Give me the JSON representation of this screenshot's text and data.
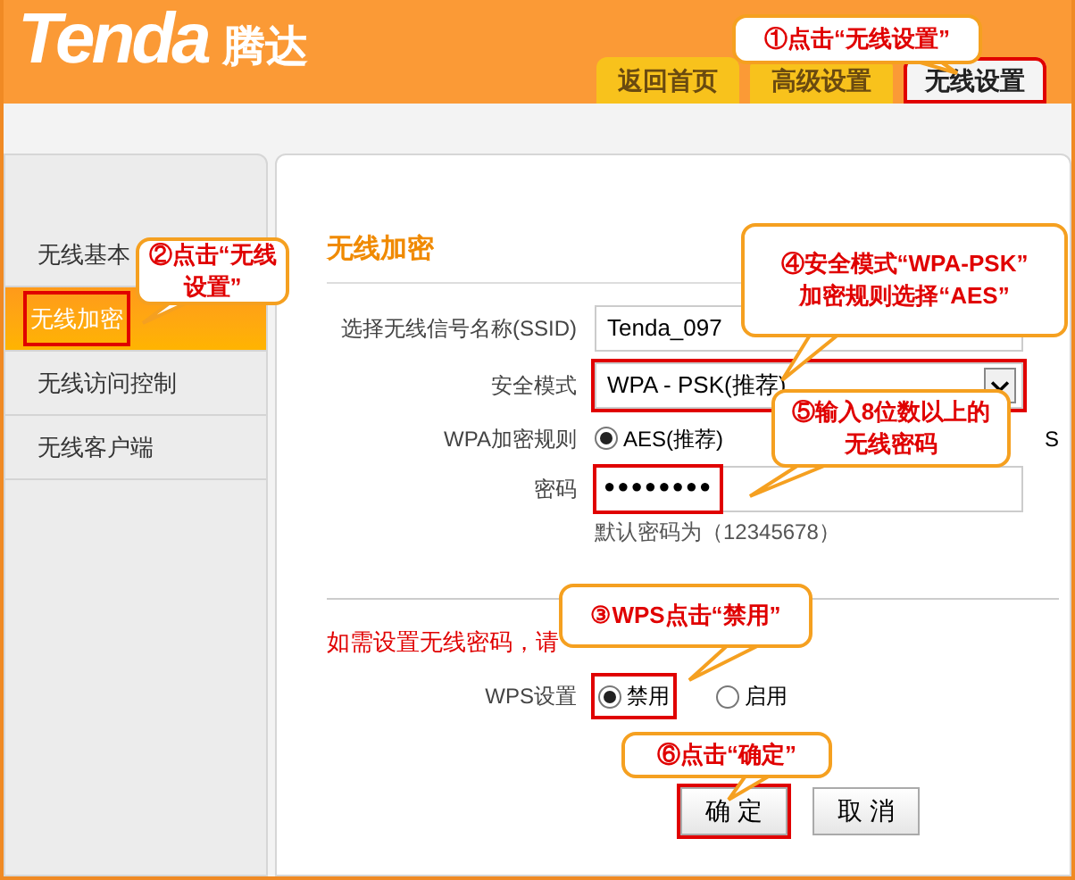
{
  "header": {
    "logo": "Tenda",
    "logo_cn": "腾达"
  },
  "tabs": [
    {
      "label": "返回首页",
      "selected": false,
      "marked": false
    },
    {
      "label": "高级设置",
      "selected": false,
      "marked": false
    },
    {
      "label": "无线设置",
      "selected": true,
      "marked": true
    }
  ],
  "sidebar": {
    "items": [
      {
        "label": "无线基本",
        "selected": false,
        "marked": false
      },
      {
        "label": "无线加密",
        "selected": true,
        "marked": true
      },
      {
        "label": "无线访问控制",
        "selected": false,
        "marked": false
      },
      {
        "label": "无线客户端",
        "selected": false,
        "marked": false
      }
    ]
  },
  "form": {
    "title": "无线加密",
    "ssid": {
      "label": "选择无线信号名称(SSID)",
      "value": "Tenda_097"
    },
    "security": {
      "label": "安全模式",
      "value": "WPA - PSK(推荐)",
      "marked": true
    },
    "cipher": {
      "label": "WPA加密规则",
      "options": [
        {
          "label": "AES(推荐)",
          "selected": true
        },
        {
          "label": "S"
        }
      ]
    },
    "password": {
      "label": "密码",
      "value": "●●●●●●●●",
      "marked": true,
      "hint": "默认密码为（12345678）"
    },
    "notice": "如需设置无线密码，请",
    "wps": {
      "label": "WPS设置",
      "options": [
        {
          "label": "禁用",
          "selected": true,
          "marked": true
        },
        {
          "label": "启用",
          "selected": false,
          "marked": false
        }
      ]
    },
    "buttons": [
      {
        "label": "确 定",
        "marked": true
      },
      {
        "label": "取 消",
        "marked": false
      }
    ]
  },
  "annotations": [
    {
      "lines": [
        "①点击“无线设置”"
      ]
    },
    {
      "lines": [
        "②点击“无线",
        "设置”"
      ]
    },
    {
      "lines": [
        "④安全模式“WPA-PSK”",
        "加密规则选择“AES”"
      ]
    },
    {
      "lines": [
        "⑤输入8位数以上的",
        "无线密码"
      ]
    },
    {
      "lines": [
        "③WPS点击“禁用”"
      ]
    },
    {
      "lines": [
        "⑥点击“确定”"
      ]
    }
  ]
}
